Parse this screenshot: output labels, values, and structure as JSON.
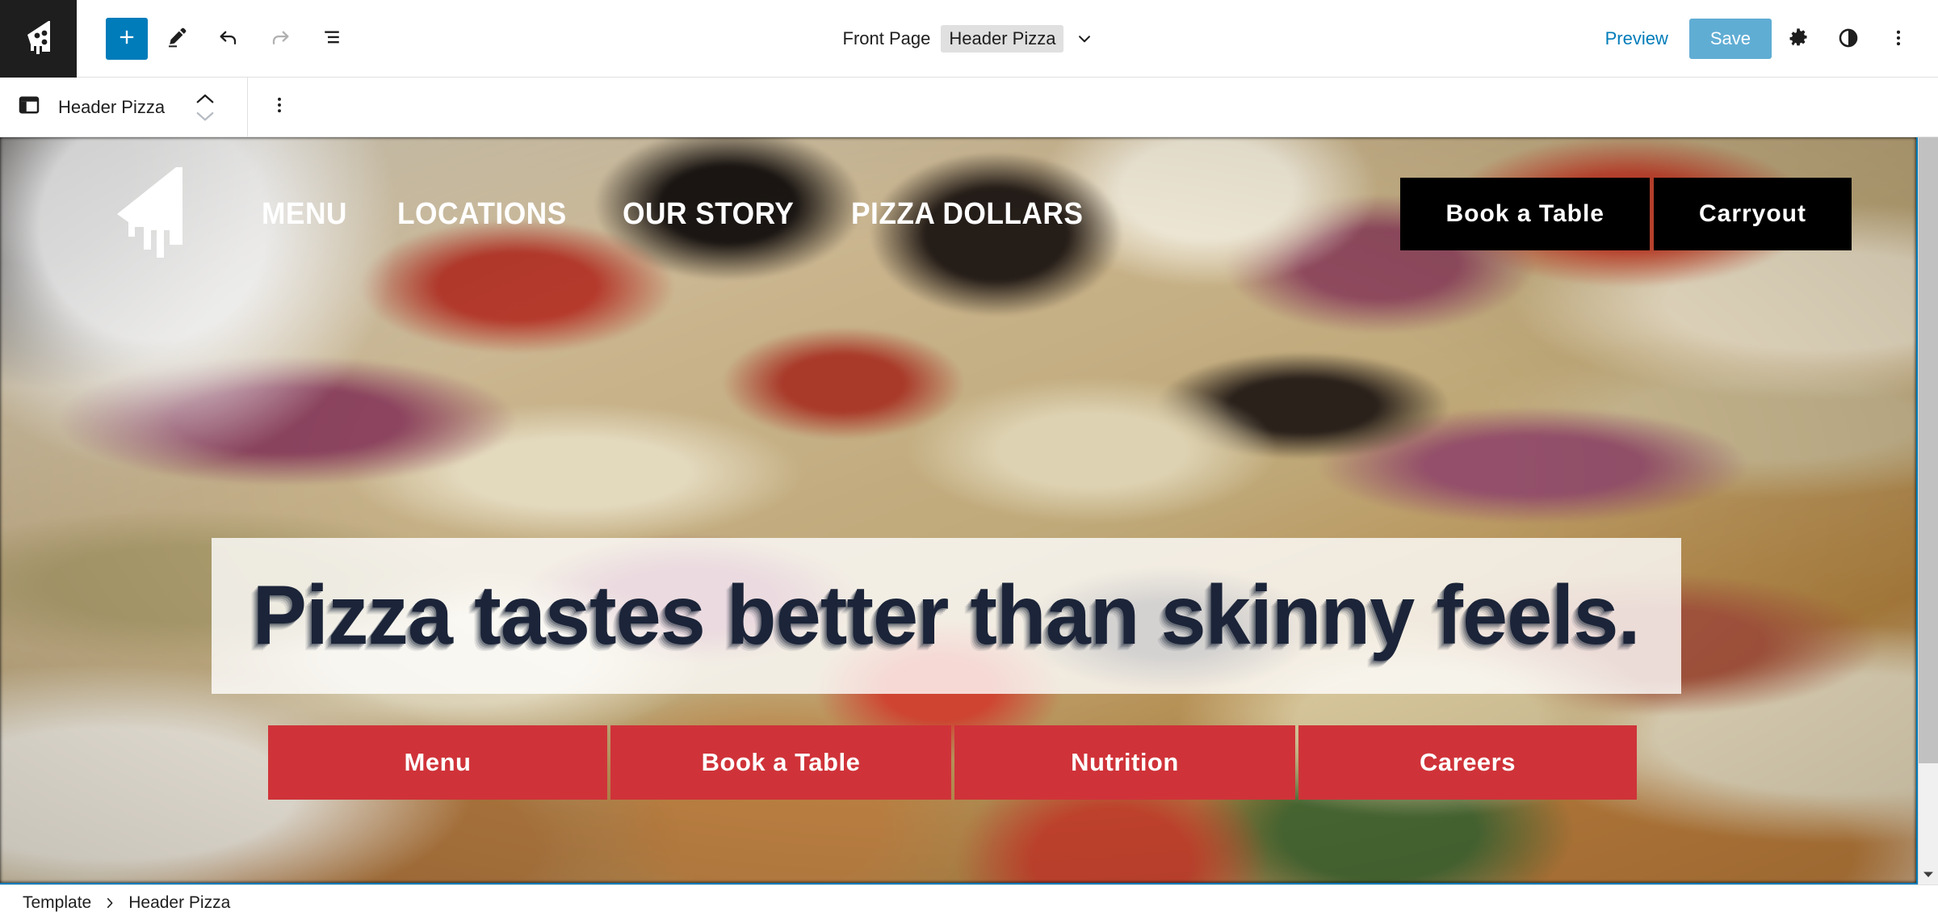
{
  "editor": {
    "logo_icon": "pizza-slice-icon",
    "toolbar_left": [
      {
        "name": "add-block-button",
        "icon": "plus-icon",
        "label": "Add block"
      },
      {
        "name": "tools-button",
        "icon": "pencil-icon",
        "label": "Tools"
      },
      {
        "name": "undo-button",
        "icon": "undo-icon",
        "label": "Undo"
      },
      {
        "name": "redo-button",
        "icon": "redo-icon",
        "label": "Redo"
      },
      {
        "name": "list-view-button",
        "icon": "list-view-icon",
        "label": "List View"
      }
    ],
    "document_title": {
      "prefix": "Front Page",
      "chip": "Header Pizza",
      "caret_icon": "chevron-down-icon"
    },
    "toolbar_right": {
      "preview_label": "Preview",
      "save_label": "Save",
      "settings_icon": "gear-icon",
      "styles_icon": "contrast-half-circle-icon",
      "options_icon": "vertical-ellipsis-icon"
    },
    "block_toolbar": {
      "block_icon": "template-part-icon",
      "block_label": "Header Pizza",
      "move_up_icon": "chevron-up-icon",
      "move_down_icon": "chevron-down-icon",
      "options_icon": "vertical-ellipsis-icon"
    },
    "breadcrumb": {
      "items": [
        "Template",
        "Header Pizza"
      ],
      "separator_icon": "chevron-right-icon"
    },
    "scrollbar": {
      "down_arrow_icon": "triangle-down-icon"
    },
    "colors": {
      "accent_blue": "#007cba",
      "chrome_dark": "#1e1e1e",
      "canvas_border": "#007cba"
    }
  },
  "site": {
    "logo_icon": "pizza-slice-logo",
    "nav": [
      {
        "label": "MENU"
      },
      {
        "label": "LOCATIONS"
      },
      {
        "label": "OUR STORY"
      },
      {
        "label": "PIZZA DOLLARS"
      }
    ],
    "header_ctas": [
      {
        "label": "Book a Table"
      },
      {
        "label": "Carryout"
      }
    ],
    "hero": {
      "headline": "Pizza tastes better than skinny feels."
    },
    "action_buttons": [
      {
        "label": "Menu"
      },
      {
        "label": "Book a Table"
      },
      {
        "label": "Nutrition"
      },
      {
        "label": "Careers"
      }
    ],
    "colors": {
      "cta_black": "#000000",
      "action_red": "#cf3339",
      "headline_navy": "#1b2438",
      "panel_white": "rgba(255,255,255,0.80)"
    }
  }
}
